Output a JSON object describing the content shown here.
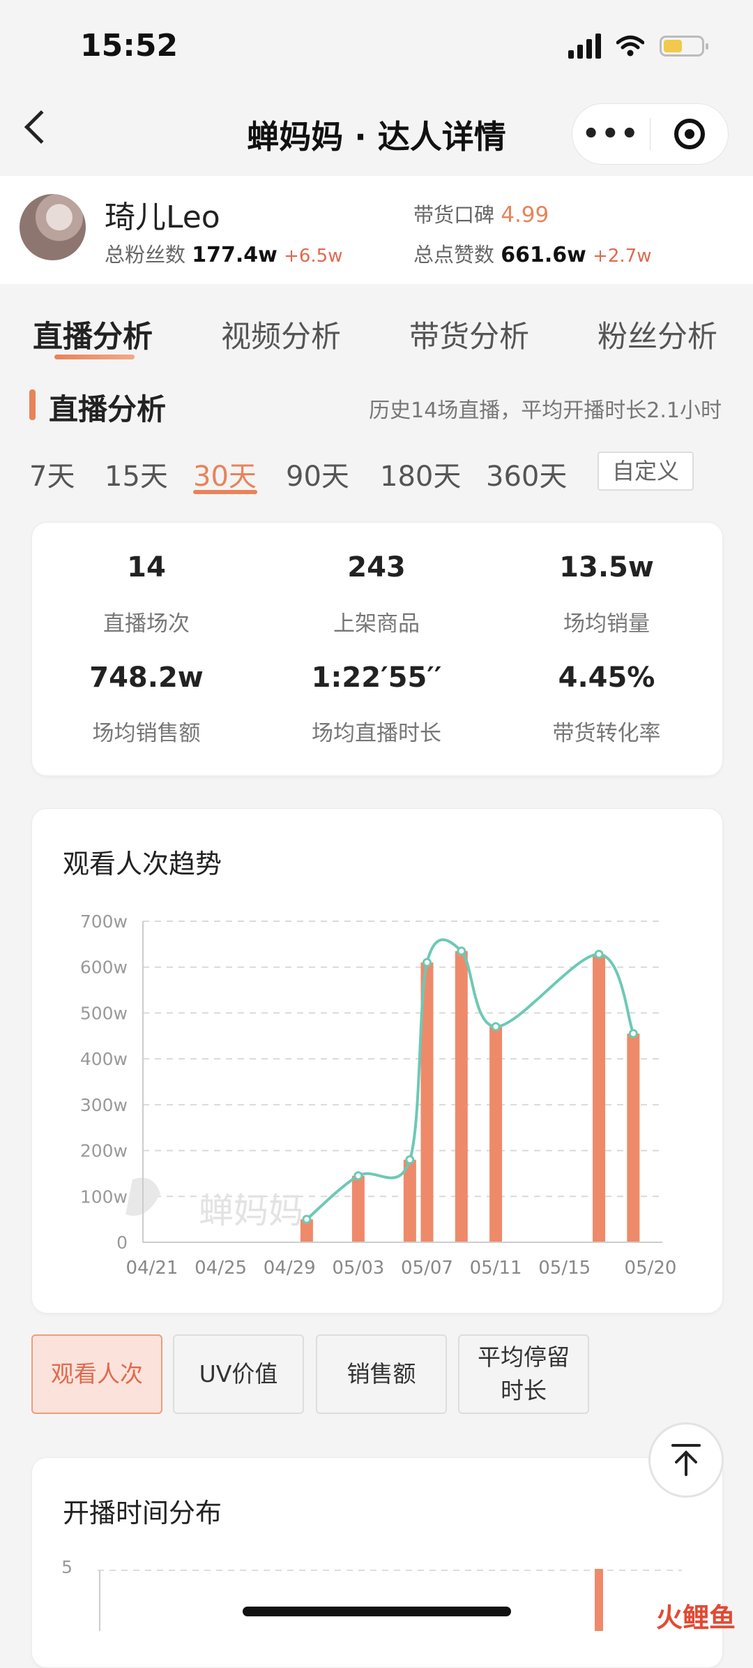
{
  "status": {
    "time": "15:52"
  },
  "nav": {
    "title": "蝉妈妈 · 达人详情",
    "more": "•••"
  },
  "profile": {
    "name": "琦儿Leo",
    "fans_label": "总粉丝数",
    "fans_value": "177.4w",
    "fans_delta": "+6.5w",
    "reputation_label": "带货口碑",
    "reputation_value": "4.99",
    "likes_label": "总点赞数",
    "likes_value": "661.6w",
    "likes_delta": "+2.7w"
  },
  "tabs": [
    "直播分析",
    "视频分析",
    "带货分析",
    "粉丝分析"
  ],
  "section": {
    "title": "直播分析",
    "summary": "历史14场直播，平均开播时长2.1小时"
  },
  "periods": [
    "7天",
    "15天",
    "30天",
    "90天",
    "180天",
    "360天"
  ],
  "period_selected": "30天",
  "custom_label": "自定义",
  "stats": [
    {
      "value": "14",
      "label": "直播场次"
    },
    {
      "value": "243",
      "label": "上架商品"
    },
    {
      "value": "13.5w",
      "label": "场均销量"
    },
    {
      "value": "748.2w",
      "label": "场均销售额"
    },
    {
      "value": "1:22′55′′",
      "label": "场均直播时长"
    },
    {
      "value": "4.45%",
      "label": "带货转化率"
    }
  ],
  "chart_title": "观看人次趋势",
  "watermark": "蝉妈妈",
  "chart_data": {
    "type": "bar",
    "title": "观看人次趋势",
    "y_unit": "w",
    "ylim": [
      0,
      700
    ],
    "yticks": [
      "0",
      "100w",
      "200w",
      "300w",
      "400w",
      "500w",
      "600w",
      "700w"
    ],
    "xticks": [
      "04/21",
      "04/25",
      "04/29",
      "05/03",
      "05/07",
      "05/11",
      "05/15",
      "05/20"
    ],
    "grid": true,
    "bars": [
      {
        "date": "04/30",
        "value": 50
      },
      {
        "date": "05/03",
        "value": 145
      },
      {
        "date": "05/06",
        "value": 180
      },
      {
        "date": "05/07",
        "value": 610
      },
      {
        "date": "05/09",
        "value": 635
      },
      {
        "date": "05/11",
        "value": 470
      },
      {
        "date": "05/17",
        "value": 628
      },
      {
        "date": "05/19",
        "value": 455
      }
    ],
    "colors": {
      "bar": "#ee8a6a",
      "line": "#6cc9b5"
    }
  },
  "metric_buttons": [
    {
      "label": "观看人次",
      "active": true
    },
    {
      "label": "UV价值",
      "active": false
    },
    {
      "label": "销售额",
      "active": false
    },
    {
      "label": "平均停留时长",
      "active": false
    }
  ],
  "dist_title": "开播时间分布",
  "dist_chart": {
    "ytick_top": "5"
  },
  "footer_logo": "火鲤鱼",
  "colors": {
    "accent": "#e8835a",
    "up": "#e06a4f"
  }
}
